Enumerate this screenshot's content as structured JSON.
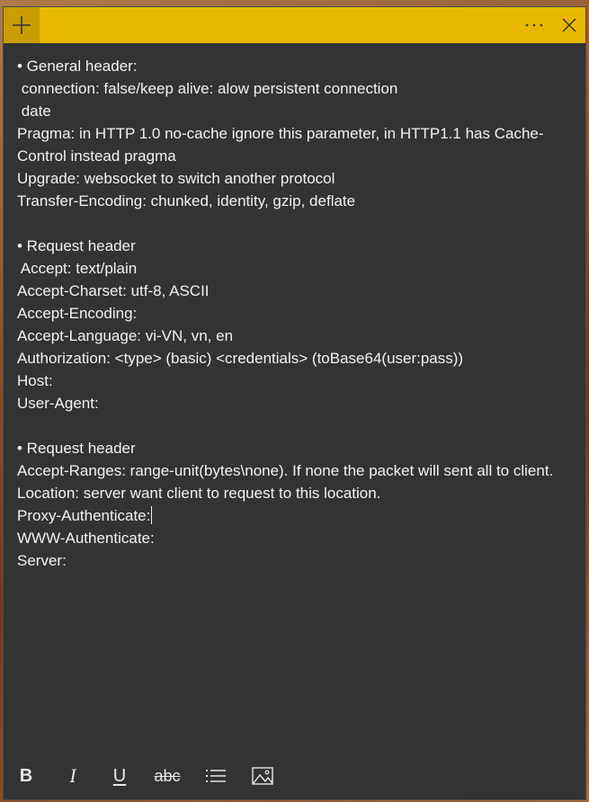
{
  "note": {
    "lines": [
      "• General header:",
      " connection: false/keep alive: alow persistent connection",
      " date",
      "Pragma: in HTTP 1.0 no-cache ignore this parameter, in HTTP1.1 has Cache-",
      "Control instead pragma",
      "Upgrade: websocket to switch another protocol",
      "Transfer-Encoding: chunked, identity, gzip, deflate",
      "",
      "• Request header",
      " Accept: text/plain",
      "Accept-Charset: utf-8, ASCII",
      "Accept-Encoding:",
      "Accept-Language: vi-VN, vn, en",
      "Authorization: <type> (basic) <credentials> (toBase64(user:pass))",
      "Host:",
      "User-Agent:",
      "",
      "• Request header",
      "Accept-Ranges: range-unit(bytes\\none). If none the packet will sent all to client.",
      "Location: server want client to request to this location.",
      "Proxy-Authenticate:",
      "WWW-Authenticate:",
      "Server:"
    ]
  },
  "toolbar": {
    "bold_label": "B",
    "italic_label": "I",
    "underline_label": "U",
    "strikethrough_label": "abc"
  },
  "icons": {
    "add": "plus-icon",
    "more": "more-icon",
    "close": "close-icon",
    "bullets": "bullet-list-icon",
    "image": "image-icon"
  },
  "colors": {
    "titlebar": "#e8b800",
    "note_background": "#333333",
    "text": "#f2f2f2"
  }
}
